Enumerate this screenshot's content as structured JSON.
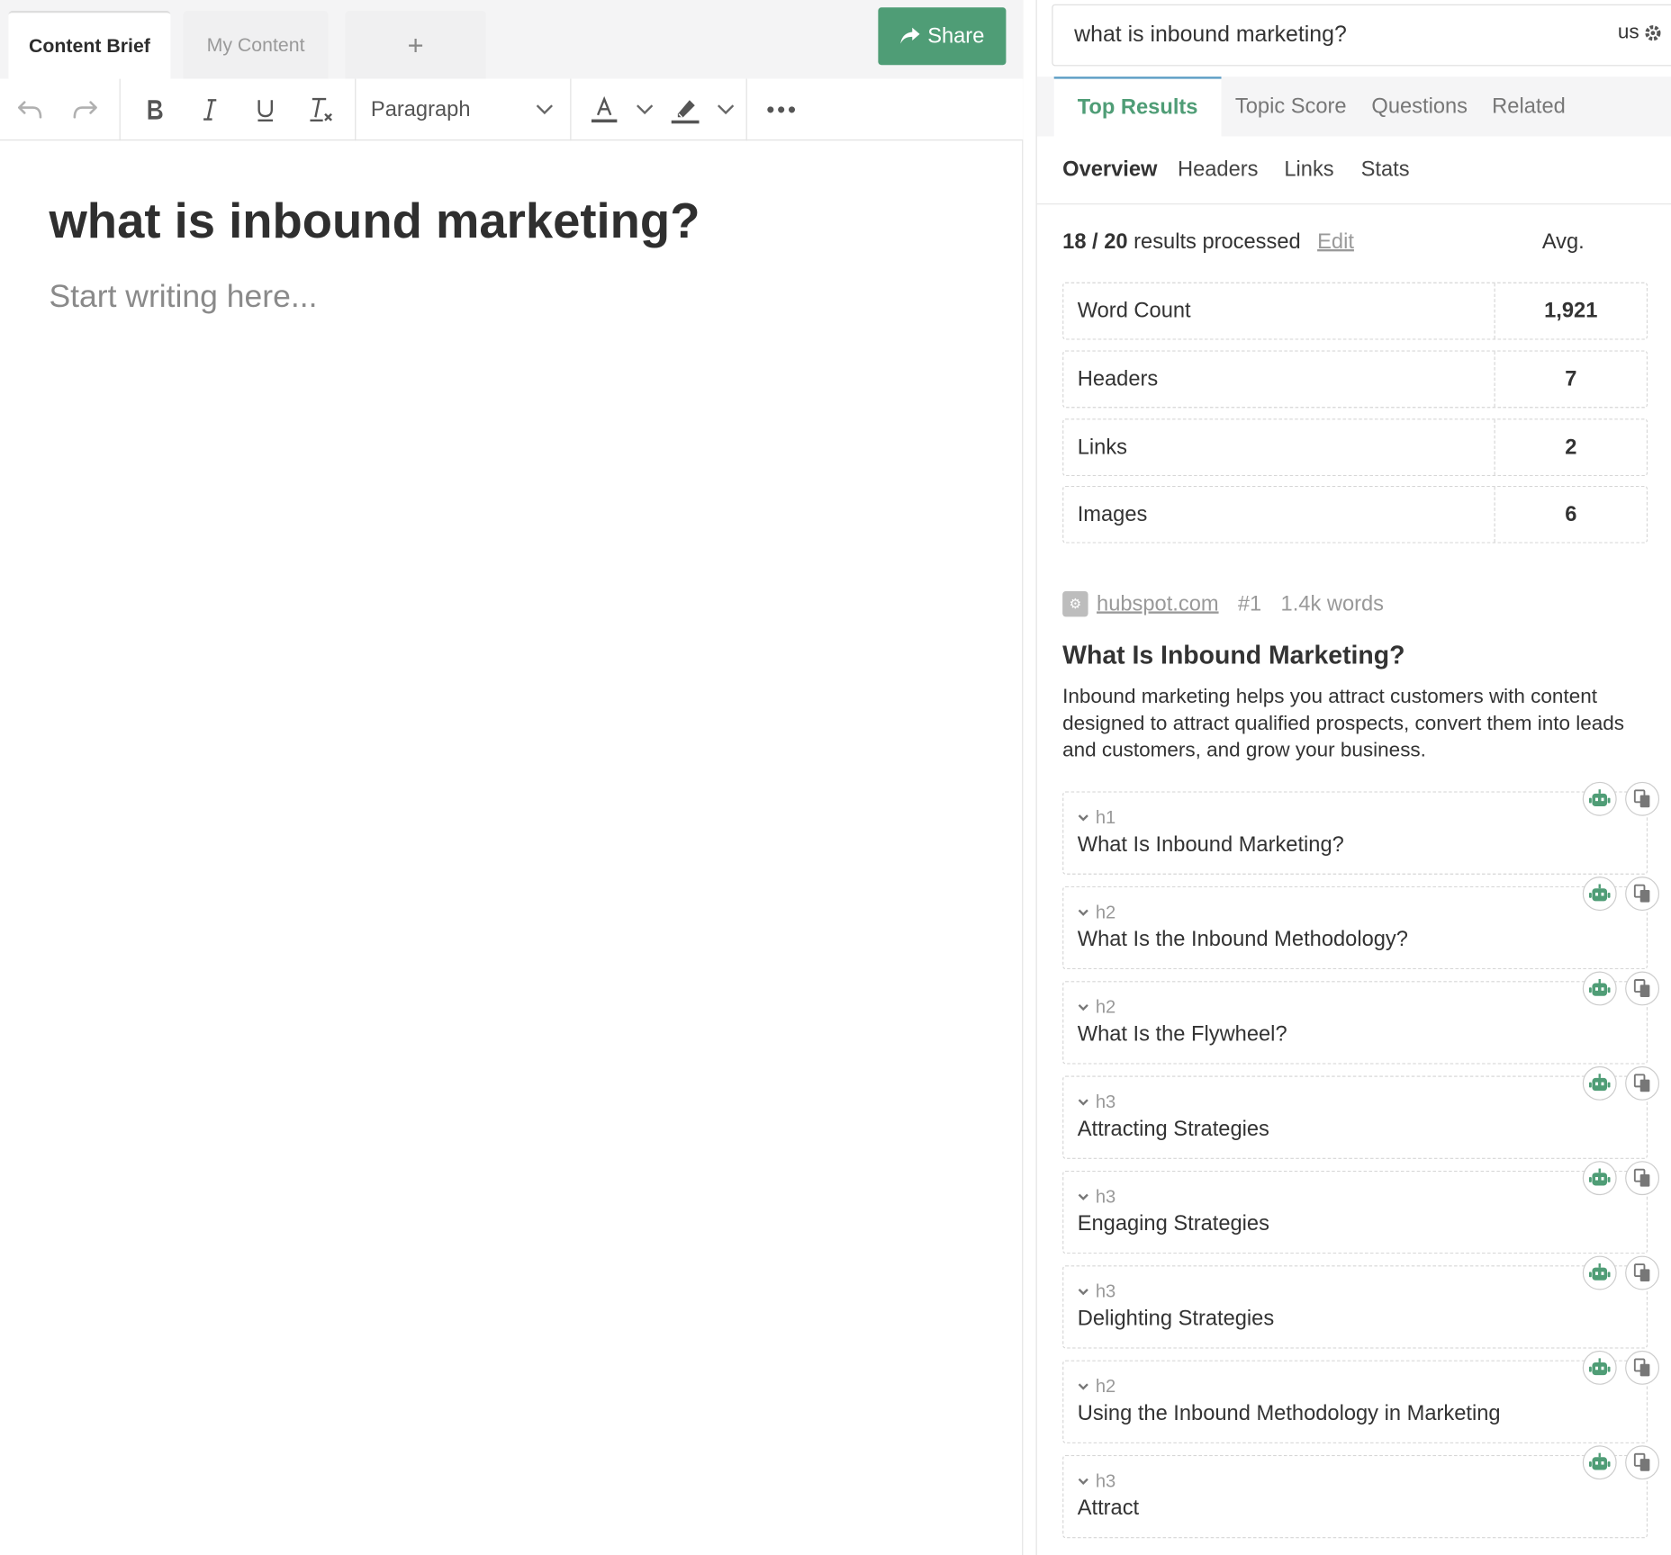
{
  "editor": {
    "tabs": [
      "Content Brief",
      "My Content"
    ],
    "add_tab_label": "+",
    "share_label": "Share",
    "toolbar": {
      "block_format": "Paragraph"
    },
    "title": "what is inbound marketing?",
    "placeholder": "Start writing here..."
  },
  "panel": {
    "search_query": "what is inbound marketing?",
    "locale": "us",
    "tabs": [
      "Top Results",
      "Topic Score",
      "Questions",
      "Related"
    ],
    "subtabs": [
      "Overview",
      "Headers",
      "Links",
      "Stats"
    ],
    "processed": {
      "count": "18 / 20",
      "text": "results processed",
      "edit_label": "Edit",
      "avg_label": "Avg."
    },
    "stats": [
      {
        "label": "Word Count",
        "value": "1,921"
      },
      {
        "label": "Headers",
        "value": "7"
      },
      {
        "label": "Links",
        "value": "2"
      },
      {
        "label": "Images",
        "value": "6"
      }
    ],
    "result": {
      "domain": "hubspot.com",
      "rank": "#1",
      "words": "1.4k words",
      "title": "What Is Inbound Marketing?",
      "description": "Inbound marketing helps you attract customers with content designed to attract qualified prospects, convert them into leads and customers, and grow your business.",
      "headings": [
        {
          "level": "h1",
          "text": "What Is Inbound Marketing?"
        },
        {
          "level": "h2",
          "text": "What Is the Inbound Methodology?"
        },
        {
          "level": "h2",
          "text": "What Is the Flywheel?"
        },
        {
          "level": "h3",
          "text": "Attracting Strategies"
        },
        {
          "level": "h3",
          "text": "Engaging Strategies"
        },
        {
          "level": "h3",
          "text": "Delighting Strategies"
        },
        {
          "level": "h2",
          "text": "Using the Inbound Methodology in Marketing"
        },
        {
          "level": "h3",
          "text": "Attract"
        }
      ]
    }
  },
  "colors": {
    "accent": "#4f9d76",
    "tab_top_border": "#5a9cc4"
  }
}
